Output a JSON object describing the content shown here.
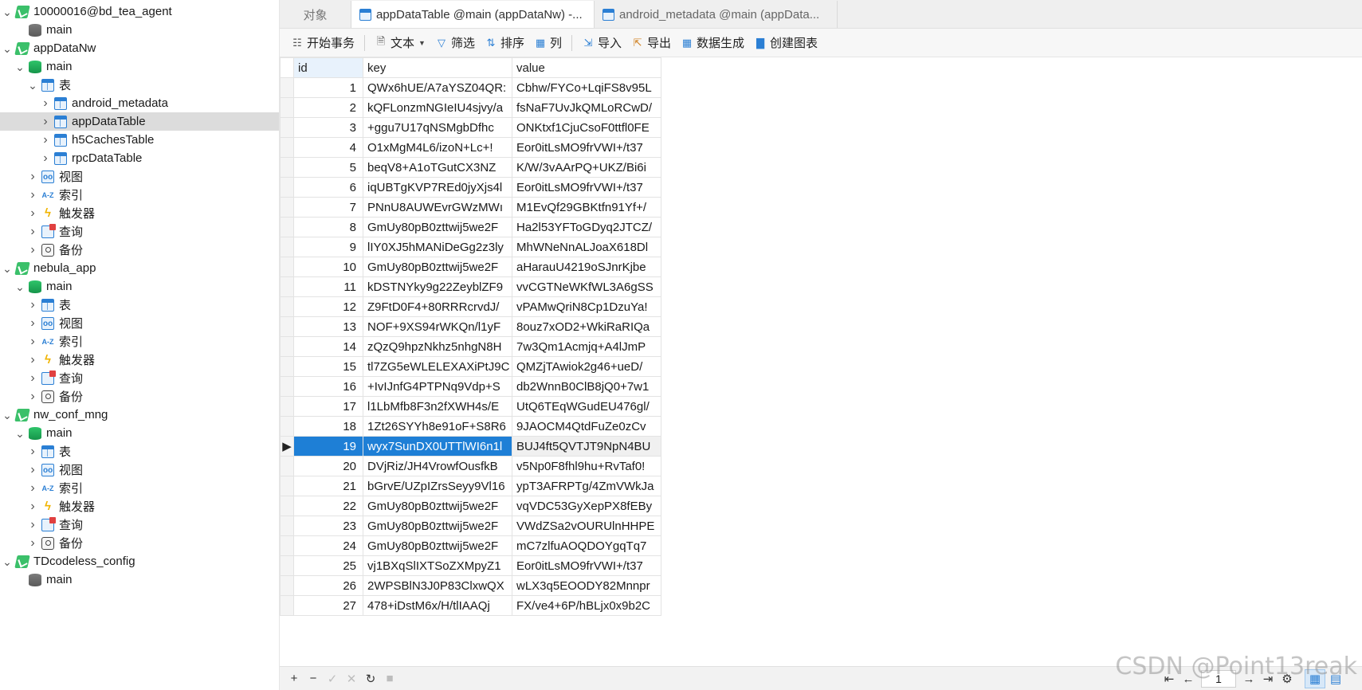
{
  "sidebar": {
    "tree": [
      {
        "label": "10000016@bd_tea_agent",
        "level": 0,
        "icon": "connection",
        "expanded": true
      },
      {
        "label": "main",
        "level": 1,
        "icon": "database-grey",
        "expanded": null
      },
      {
        "label": "appDataNw",
        "level": 0,
        "icon": "connection",
        "expanded": true
      },
      {
        "label": "main",
        "level": 1,
        "icon": "database-green",
        "expanded": true
      },
      {
        "label": "表",
        "level": 2,
        "icon": "table",
        "expanded": true
      },
      {
        "label": "android_metadata",
        "level": 3,
        "icon": "table",
        "expanded": false
      },
      {
        "label": "appDataTable",
        "level": 3,
        "icon": "table",
        "expanded": false,
        "selected": true
      },
      {
        "label": "h5CachesTable",
        "level": 3,
        "icon": "table",
        "expanded": false
      },
      {
        "label": "rpcDataTable",
        "level": 3,
        "icon": "table",
        "expanded": false
      },
      {
        "label": "视图",
        "level": 2,
        "icon": "view",
        "expanded": false
      },
      {
        "label": "索引",
        "level": 2,
        "icon": "index",
        "expanded": false
      },
      {
        "label": "触发器",
        "level": 2,
        "icon": "trigger",
        "expanded": false
      },
      {
        "label": "查询",
        "level": 2,
        "icon": "query",
        "expanded": false
      },
      {
        "label": "备份",
        "level": 2,
        "icon": "backup",
        "expanded": false
      },
      {
        "label": "nebula_app",
        "level": 0,
        "icon": "connection",
        "expanded": true
      },
      {
        "label": "main",
        "level": 1,
        "icon": "database-green",
        "expanded": true
      },
      {
        "label": "表",
        "level": 2,
        "icon": "table",
        "expanded": false
      },
      {
        "label": "视图",
        "level": 2,
        "icon": "view",
        "expanded": false
      },
      {
        "label": "索引",
        "level": 2,
        "icon": "index",
        "expanded": false
      },
      {
        "label": "触发器",
        "level": 2,
        "icon": "trigger",
        "expanded": false
      },
      {
        "label": "查询",
        "level": 2,
        "icon": "query",
        "expanded": false
      },
      {
        "label": "备份",
        "level": 2,
        "icon": "backup",
        "expanded": false
      },
      {
        "label": "nw_conf_mng",
        "level": 0,
        "icon": "connection",
        "expanded": true
      },
      {
        "label": "main",
        "level": 1,
        "icon": "database-green",
        "expanded": true
      },
      {
        "label": "表",
        "level": 2,
        "icon": "table",
        "expanded": false
      },
      {
        "label": "视图",
        "level": 2,
        "icon": "view",
        "expanded": false
      },
      {
        "label": "索引",
        "level": 2,
        "icon": "index",
        "expanded": false
      },
      {
        "label": "触发器",
        "level": 2,
        "icon": "trigger",
        "expanded": false
      },
      {
        "label": "查询",
        "level": 2,
        "icon": "query",
        "expanded": false
      },
      {
        "label": "备份",
        "level": 2,
        "icon": "backup",
        "expanded": false
      },
      {
        "label": "TDcodeless_config",
        "level": 0,
        "icon": "connection",
        "expanded": true
      },
      {
        "label": "main",
        "level": 1,
        "icon": "database-grey",
        "expanded": null
      }
    ]
  },
  "tabs": {
    "objects": "对象",
    "active": "appDataTable @main (appDataNw) -...",
    "inactive": "android_metadata @main (appData..."
  },
  "toolbar": {
    "begin_transaction": "开始事务",
    "text": "文本",
    "filter": "筛选",
    "sort": "排序",
    "columns": "列",
    "import": "导入",
    "export": "导出",
    "data_generation": "数据生成",
    "create_chart": "创建图表"
  },
  "grid": {
    "columns": [
      "id",
      "key",
      "value"
    ],
    "selected_row": 19,
    "rows": [
      {
        "id": "1",
        "key": "QWx6hUE/A7aYSZ04QR:",
        "value": "Cbhw/FYCo+LqiFS8v95L"
      },
      {
        "id": "2",
        "key": "kQFLonzmNGIeIU4sjvy/a",
        "value": "fsNaF7UvJkQMLoRCwD/"
      },
      {
        "id": "3",
        "key": "+ggu7U17qNSMgbDfhc",
        "value": "ONKtxf1CjuCsoF0ttfl0FE"
      },
      {
        "id": "4",
        "key": "O1xMgM4L6/izoN+Lc+!",
        "value": "Eor0itLsMO9frVWI+/t37"
      },
      {
        "id": "5",
        "key": "beqV8+A1oTGutCX3NZ",
        "value": "K/W/3vAArPQ+UKZ/Bi6i"
      },
      {
        "id": "6",
        "key": "iqUBTgKVP7REd0jyXjs4l",
        "value": "Eor0itLsMO9frVWI+/t37"
      },
      {
        "id": "7",
        "key": "PNnU8AUWEvrGWzMWı",
        "value": "M1EvQf29GBKtfn91Yf+/"
      },
      {
        "id": "8",
        "key": "GmUy80pB0zttwij5we2F",
        "value": "Ha2l53YFToGDyq2JTCZ/"
      },
      {
        "id": "9",
        "key": "lIY0XJ5hMANiDeGg2z3ly",
        "value": "MhWNeNnALJoaX618Dl"
      },
      {
        "id": "10",
        "key": "GmUy80pB0zttwij5we2F",
        "value": "aHarauU4219oSJnrKjbe"
      },
      {
        "id": "11",
        "key": "kDSTNYky9g22ZeyblZF9",
        "value": "vvCGTNeWKfWL3A6gSS"
      },
      {
        "id": "12",
        "key": "Z9FtD0F4+80RRRcrvdJ/",
        "value": "vPAMwQriN8Cp1DzuYa!"
      },
      {
        "id": "13",
        "key": "NOF+9XS94rWKQn/l1yF",
        "value": "8ouz7xOD2+WkiRaRIQa"
      },
      {
        "id": "14",
        "key": "zQzQ9hpzNkhz5nhgN8H",
        "value": "7w3Qm1Acmjq+A4lJmP"
      },
      {
        "id": "15",
        "key": "tl7ZG5eWLELEXAXiPtJ9C",
        "value": "QMZjTAwiok2g46+ueD/"
      },
      {
        "id": "16",
        "key": "+IvIJnfG4PTPNq9Vdp+S",
        "value": "db2WnnB0ClB8jQ0+7w1"
      },
      {
        "id": "17",
        "key": "l1LbMfb8F3n2fXWH4s/E",
        "value": "UtQ6TEqWGudEU476gl/"
      },
      {
        "id": "18",
        "key": "1Zt26SYYh8e91oF+S8R6",
        "value": "9JAOCM4QtdFuZe0zCv"
      },
      {
        "id": "19",
        "key": "wyx7SunDX0UTTlWI6n1l",
        "value": "BUJ4ft5QVTJT9NpN4BU"
      },
      {
        "id": "20",
        "key": "DVjRiz/JH4VrowfOusfkB",
        "value": "v5Np0F8fhl9hu+RvTaf0!"
      },
      {
        "id": "21",
        "key": "bGrvE/UZpIZrsSeyy9Vl16",
        "value": "ypT3AFRPTg/4ZmVWkJa"
      },
      {
        "id": "22",
        "key": "GmUy80pB0zttwij5we2F",
        "value": "vqVDC53GyXepPX8fEBy"
      },
      {
        "id": "23",
        "key": "GmUy80pB0zttwij5we2F",
        "value": "VWdZSa2vOURUlnHHPE"
      },
      {
        "id": "24",
        "key": "GmUy80pB0zttwij5we2F",
        "value": "mC7zlfuAOQDOYgqTq7"
      },
      {
        "id": "25",
        "key": "vj1BXqSlIXTSoZXMpyZ1",
        "value": "Eor0itLsMO9frVWI+/t37"
      },
      {
        "id": "26",
        "key": "2WPSBlN3J0P83ClxwQX",
        "value": "wLX3q5EOODY82Mnnpr"
      },
      {
        "id": "27",
        "key": "478+iDstM6x/H/tlIAAQj",
        "value": "FX/ve4+6P/hBLjx0x9b2C"
      }
    ]
  },
  "statusbar": {
    "page": "1",
    "add_icon": "plus-icon",
    "remove_icon": "minus-icon",
    "apply_icon": "check-icon",
    "discard_icon": "x-icon",
    "refresh_icon": "refresh-icon",
    "stop_icon": "stop-icon"
  },
  "watermark": "CSDN @Point13reak",
  "colors": {
    "selection_blue": "#1e7fd6",
    "tree_selected": "#dcdcdc",
    "db_green": "#16954a",
    "accent_blue": "#2b7fd4"
  }
}
